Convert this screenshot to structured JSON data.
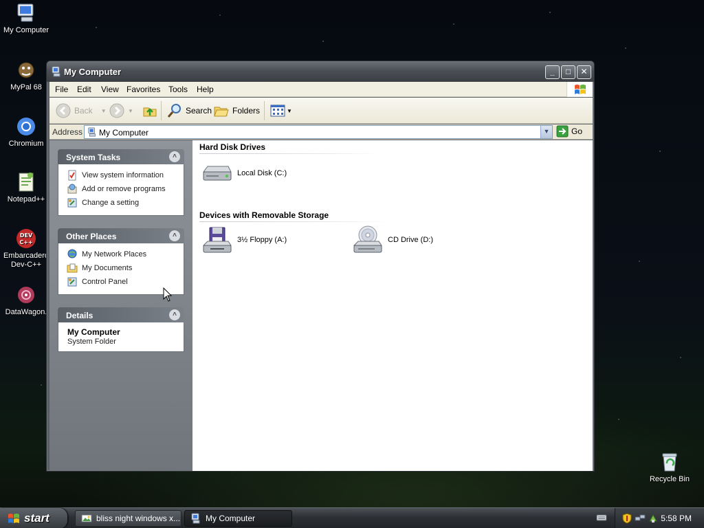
{
  "desktop": {
    "icons": [
      {
        "label": "My Computer",
        "icon": "my-computer-icon"
      },
      {
        "label": "MyPal 68",
        "icon": "mypal-icon"
      },
      {
        "label": "Chromium",
        "icon": "chromium-icon"
      },
      {
        "label": "Notepad++",
        "icon": "notepad-plus-plus-icon"
      },
      {
        "label": "Embarcadero Dev-C++",
        "icon": "devcpp-icon",
        "badge": "DEV\nC++"
      },
      {
        "label": "DataWagon.",
        "icon": "datawagon-icon"
      },
      {
        "label": "Recycle Bin",
        "icon": "recycle-bin-icon"
      }
    ]
  },
  "window": {
    "title": "My Computer",
    "controls": {
      "minimize": "_",
      "maximize": "□",
      "close": "✕"
    }
  },
  "menu": [
    "File",
    "Edit",
    "View",
    "Favorites",
    "Tools",
    "Help"
  ],
  "toolbar": {
    "back": "Back",
    "search": "Search",
    "folders": "Folders"
  },
  "address": {
    "label": "Address",
    "value": "My Computer",
    "go": "Go"
  },
  "taskpane": {
    "system_tasks": {
      "title": "System Tasks",
      "items": [
        "View system information",
        "Add or remove programs",
        "Change a setting"
      ]
    },
    "other_places": {
      "title": "Other Places",
      "items": [
        "My Network Places",
        "My Documents",
        "Control Panel"
      ]
    },
    "details": {
      "title": "Details",
      "name": "My Computer",
      "type": "System Folder"
    }
  },
  "explorer": {
    "groups": [
      {
        "title": "Hard Disk Drives",
        "items": [
          {
            "label": "Local Disk (C:)",
            "icon": "hard-disk-icon"
          }
        ]
      },
      {
        "title": "Devices with Removable Storage",
        "items": [
          {
            "label": "3½ Floppy (A:)",
            "icon": "floppy-drive-icon"
          },
          {
            "label": "CD Drive (D:)",
            "icon": "cd-drive-icon"
          }
        ]
      }
    ]
  },
  "taskbar": {
    "start": "start",
    "tasks": [
      {
        "label": "bliss night windows x...",
        "active": false
      },
      {
        "label": "My Computer",
        "active": true
      }
    ],
    "clock": "5:58 PM"
  },
  "colors": {
    "titlebar": "#4b4f55",
    "menubar": "#f1efe2",
    "taskpane": "#7f858b",
    "taskbar": "#2d3034"
  }
}
